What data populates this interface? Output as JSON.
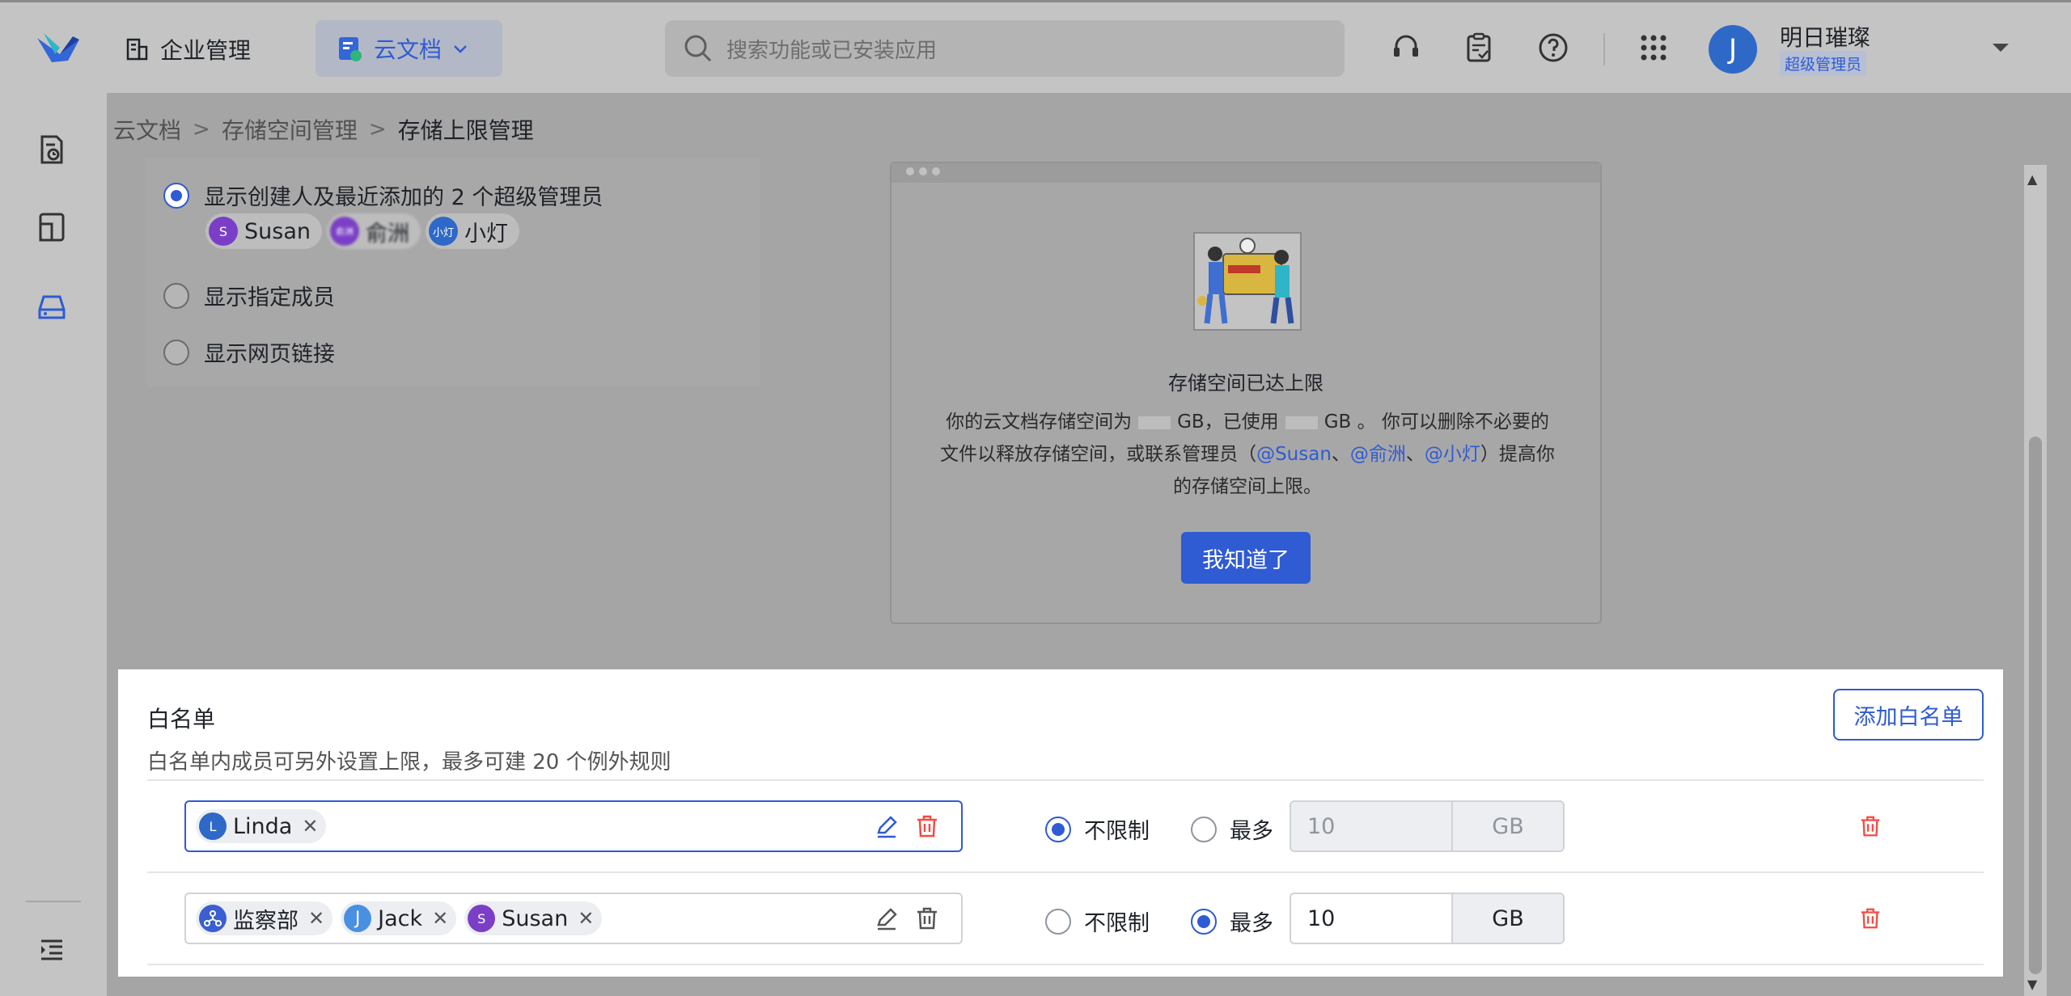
{
  "header": {
    "org_label": "企业管理",
    "app_label": "云文档",
    "search_placeholder": "搜索功能或已安装应用",
    "user_name": "明日璀璨",
    "user_role": "超级管理员",
    "user_initial": "J"
  },
  "breadcrumb": {
    "items": [
      "云文档",
      "存储空间管理",
      "存储上限管理"
    ],
    "separator": ">"
  },
  "display_options": {
    "option1": "显示创建人及最近添加的 2 个超级管理员",
    "option2": "显示指定成员",
    "option3": "显示网页链接",
    "chips": [
      {
        "initial": "S",
        "name": "Susan",
        "color": "#7b3fc7"
      },
      {
        "initial": "俞洲",
        "name": "俞洲",
        "color": "#7b3fc7"
      },
      {
        "initial": "小灯",
        "name": "小灯",
        "color": "#2e69c7"
      }
    ]
  },
  "preview": {
    "title": "存储空间已达上限",
    "line1_a": "你的云文档存储空间为",
    "line1_b": "GB，已使用",
    "line1_c": "GB 。 你可以删除不必要的",
    "line2_a": "文件以释放存储空间，或联系管理员（",
    "mention1": "@Susan",
    "sep": "、",
    "mention2": "@俞洲",
    "mention3": "@小灯",
    "line2_b": "）提高你",
    "line3": "的存储空间上限。",
    "button": "我知道了"
  },
  "whitelist": {
    "title": "白名单",
    "description": "白名单内成员可另外设置上限，最多可建 20 个例外规则",
    "add_button": "添加白名单",
    "unlimited_label": "不限制",
    "max_label": "最多",
    "unit": "GB",
    "rows": [
      {
        "members": [
          {
            "initial": "L",
            "name": "Linda",
            "color": "#2e69c7"
          }
        ],
        "mode": "unlimited",
        "limit_value": "10"
      },
      {
        "members": [
          {
            "initial": "dept",
            "name": "监察部",
            "color": "#3b5fd0"
          },
          {
            "initial": "J",
            "name": "Jack",
            "color": "#4a90e2"
          },
          {
            "initial": "S",
            "name": "Susan",
            "color": "#7b3fc7"
          }
        ],
        "mode": "max",
        "limit_value": "10"
      }
    ]
  },
  "colors": {
    "accent": "#2f5bd3",
    "danger": "#f54a45"
  }
}
